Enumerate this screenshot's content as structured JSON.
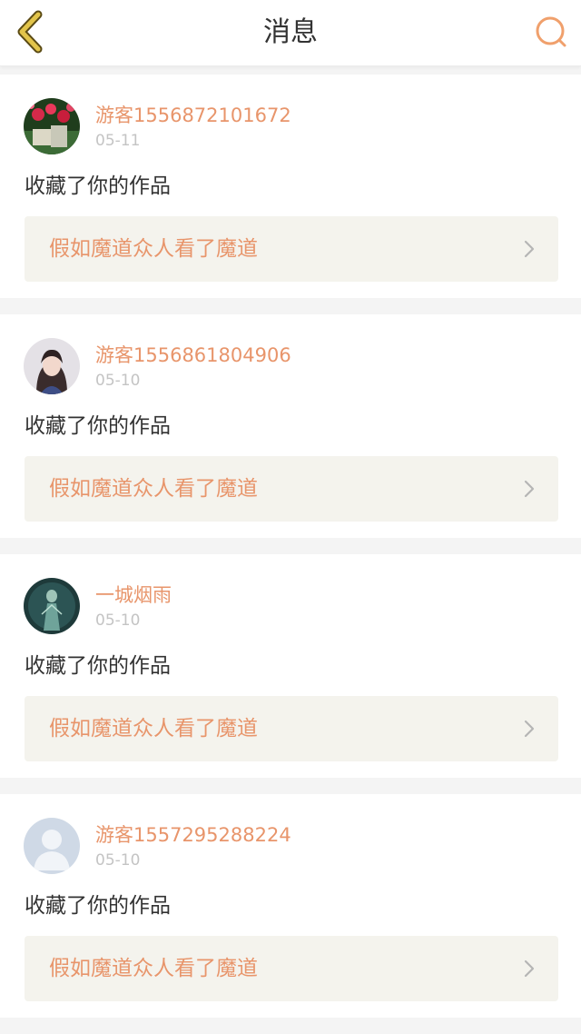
{
  "header": {
    "title": "消息",
    "back_icon": "chevron-left-icon",
    "search_icon": "search-icon",
    "accent_color": "#e8956b",
    "back_color": "#d8b43c"
  },
  "messages": [
    {
      "username": "游客1556872101672",
      "date": "05-11",
      "action": "收藏了你的作品",
      "work_title": "假如魔道众人看了魔道",
      "avatar": "avatar-flowers-photo"
    },
    {
      "username": "游客1556861804906",
      "date": "05-10",
      "action": "收藏了你的作品",
      "work_title": "假如魔道众人看了魔道",
      "avatar": "avatar-girl-photo"
    },
    {
      "username": "一城烟雨",
      "date": "05-10",
      "action": "收藏了你的作品",
      "work_title": "假如魔道众人看了魔道",
      "avatar": "avatar-teal-figure-photo"
    },
    {
      "username": "游客1557295288224",
      "date": "05-10",
      "action": "收藏了你的作品",
      "work_title": "假如魔道众人看了魔道",
      "avatar": "default-user-avatar"
    }
  ]
}
